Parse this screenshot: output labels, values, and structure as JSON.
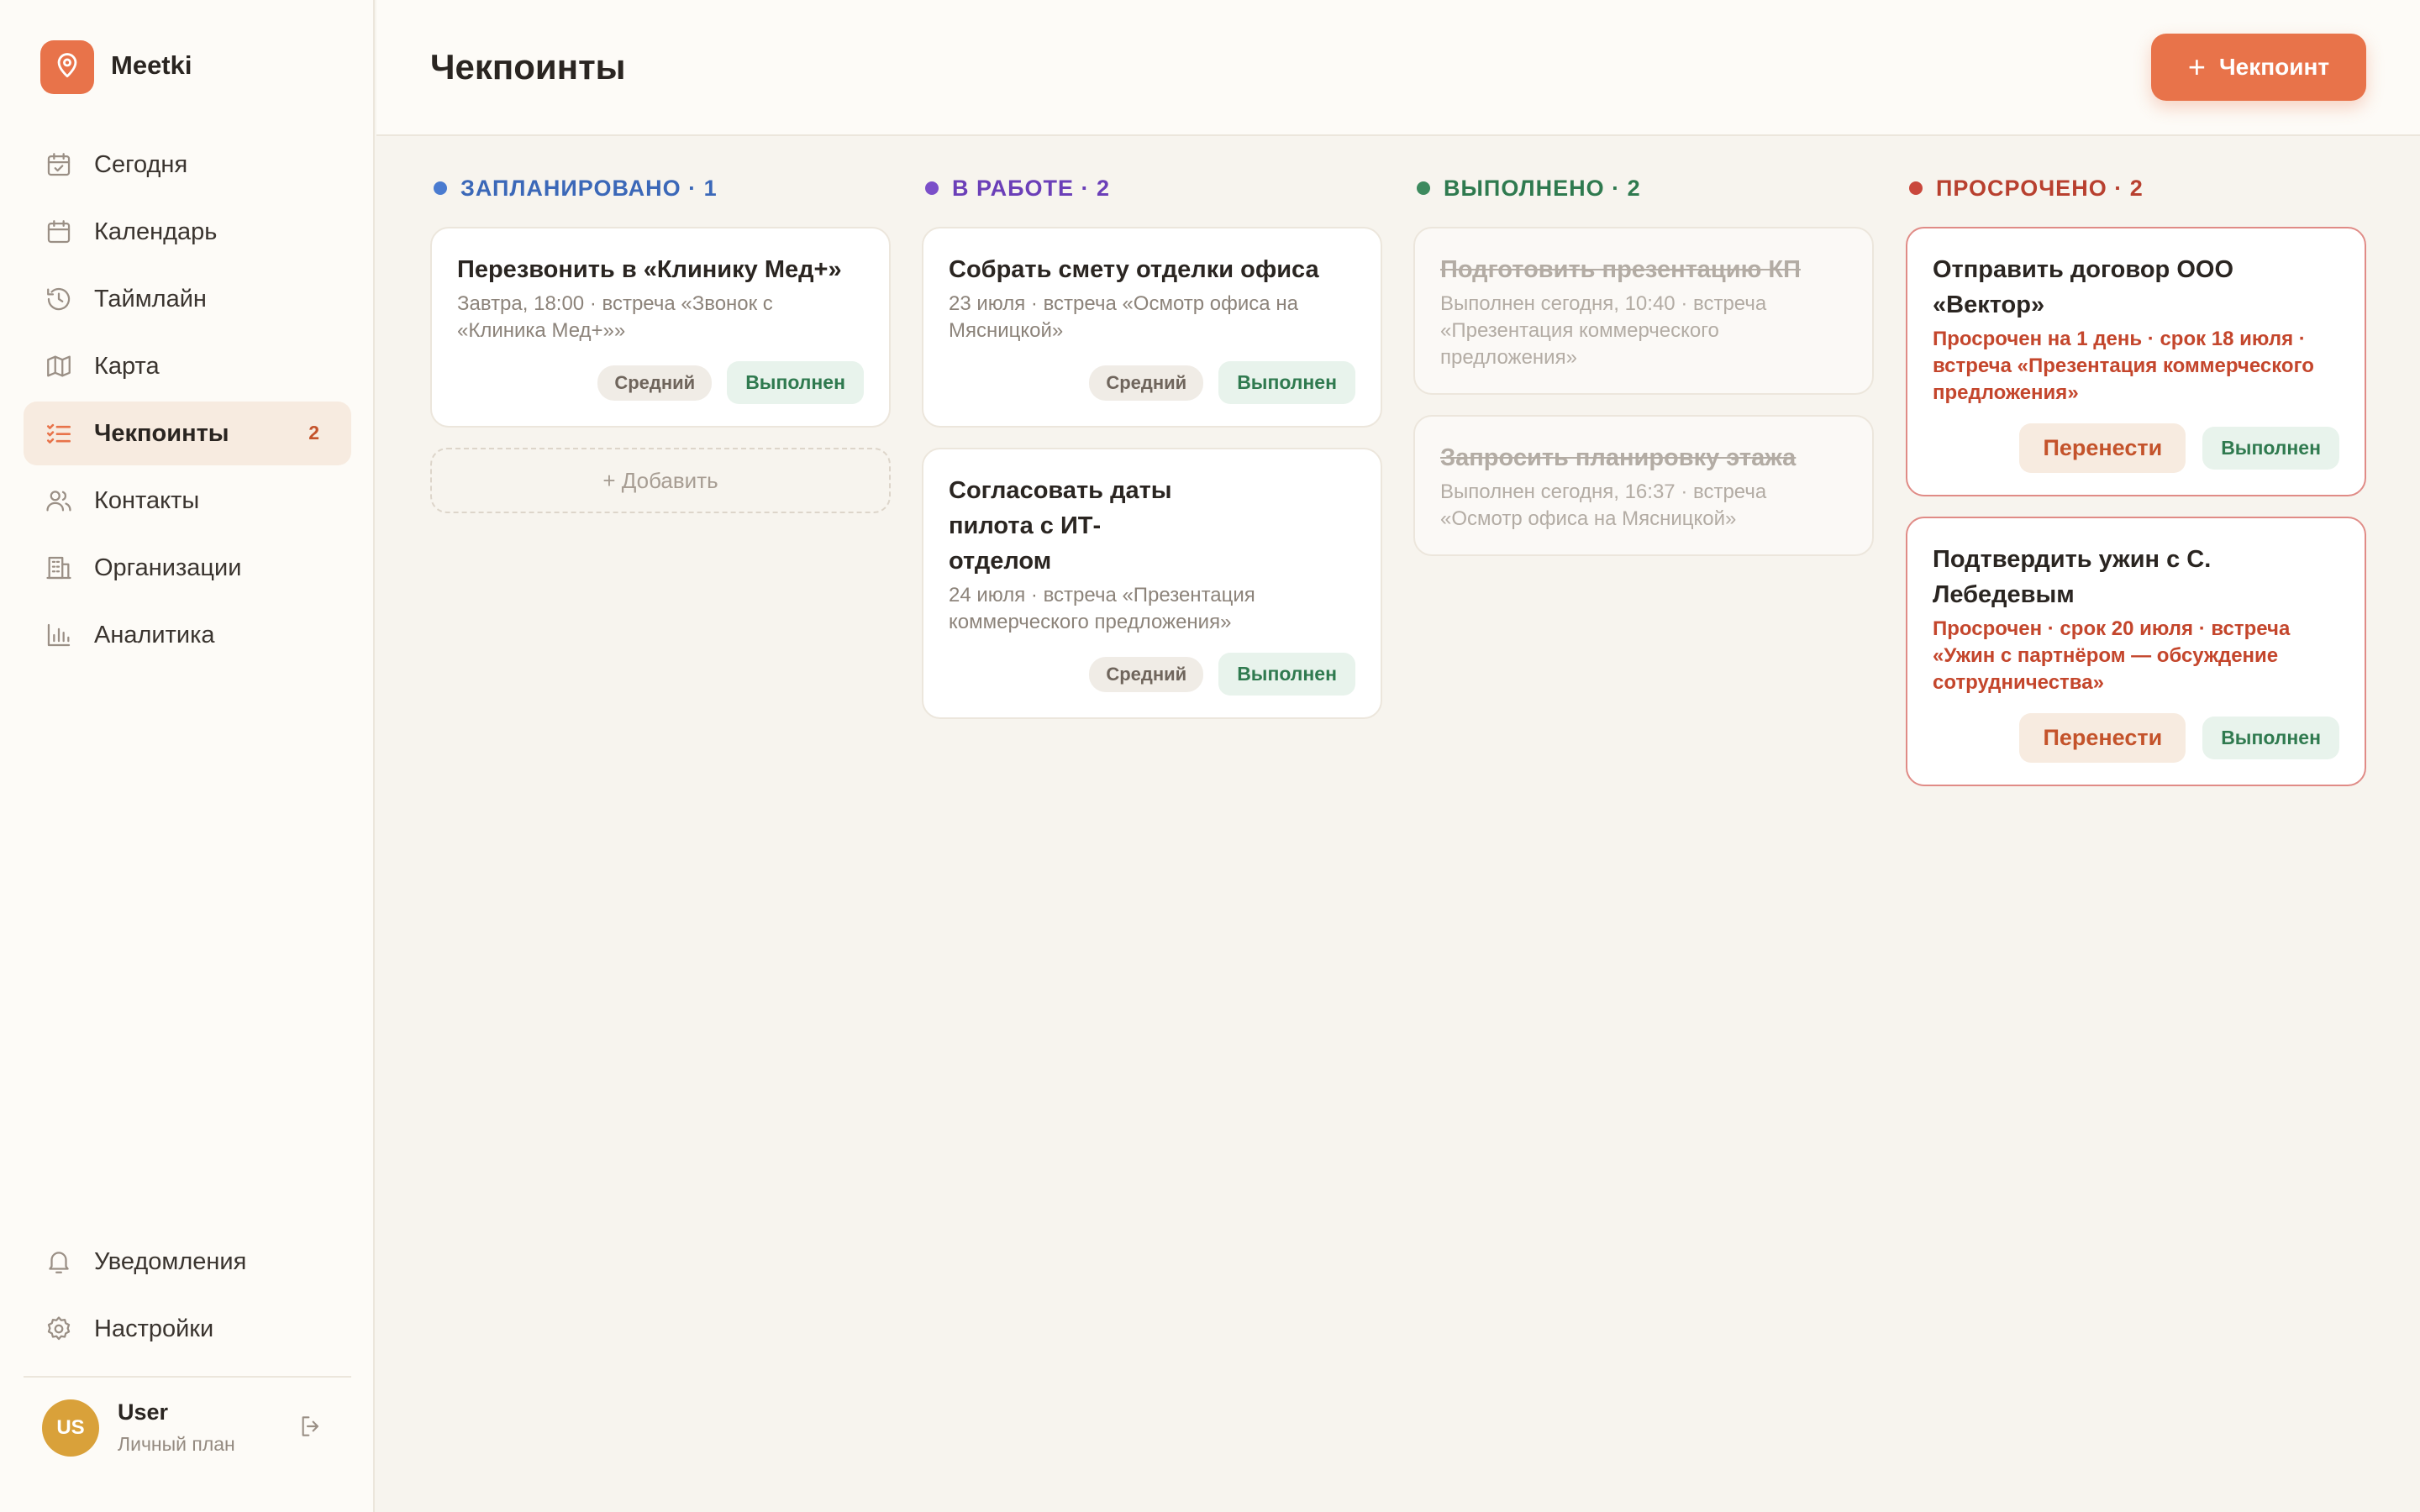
{
  "app": {
    "name": "Meetki"
  },
  "sidebar": {
    "items": [
      {
        "label": "Сегодня",
        "icon": "calendar-check-icon"
      },
      {
        "label": "Календарь",
        "icon": "calendar-icon"
      },
      {
        "label": "Таймлайн",
        "icon": "history-icon"
      },
      {
        "label": "Карта",
        "icon": "map-icon"
      },
      {
        "label": "Чекпоинты",
        "icon": "checklist-icon",
        "badge": "2",
        "active": true
      },
      {
        "label": "Контакты",
        "icon": "users-icon"
      },
      {
        "label": "Организации",
        "icon": "building-icon"
      },
      {
        "label": "Аналитика",
        "icon": "bar-chart-icon"
      }
    ],
    "bottom": [
      {
        "label": "Уведомления",
        "icon": "bell-icon"
      },
      {
        "label": "Настройки",
        "icon": "gear-icon"
      }
    ],
    "user": {
      "initials": "US",
      "name": "User",
      "plan": "Личный план"
    }
  },
  "header": {
    "title": "Чекпоинты",
    "add_label": "Чекпоинт"
  },
  "colors": {
    "accent": "#e8734a",
    "planned": "#4a7bd0",
    "in_progress": "#7b4fc9",
    "done": "#3d8a5e",
    "overdue": "#c9473c"
  },
  "columns": [
    {
      "title": "ЗАПЛАНИРОВАНО · 1",
      "cards": [
        {
          "title": "Перезвонить в «Клинику Мед+»",
          "meta": "Завтра, 18:00 · встреча «Звонок с «Клиника Мед+»»",
          "priority": "Средний",
          "done_label": "Выполнен"
        }
      ],
      "add_label": "+ Добавить"
    },
    {
      "title": "В РАБОТЕ · 2",
      "cards": [
        {
          "title": "Собрать смету отделки офиса",
          "meta": "23 июля · встреча «Осмотр офиса на Мясницкой»",
          "priority": "Средний",
          "done_label": "Выполнен"
        },
        {
          "title": "Согласовать даты пилота с ИТ-отделом",
          "meta": "24 июля · встреча «Презентация коммерческого предложения»",
          "priority": "Средний",
          "done_label": "Выполнен"
        }
      ]
    },
    {
      "title": "ВЫПОЛНЕНО · 2",
      "cards": [
        {
          "title": "Подготовить презентацию КП",
          "meta": "Выполнен сегодня, 10:40 · встреча «Презентация коммерческого предложения»"
        },
        {
          "title": "Запросить планировку этажа",
          "meta": "Выполнен сегодня, 16:37 · встреча «Осмотр офиса на Мясницкой»"
        }
      ]
    },
    {
      "title": "ПРОСРОЧЕНО · 2",
      "cards": [
        {
          "title": "Отправить договор ООО «Вектор»",
          "meta": "Просрочен на 1 день · срок 18 июля · встреча «Презентация коммерческого предложения»",
          "move_label": "Перенести",
          "done_label": "Выполнен"
        },
        {
          "title": "Подтвердить ужин с С. Лебедевым",
          "meta": "Просрочен · срок 20 июля · встреча «Ужин с партнёром — обсуждение сотрудничества»",
          "move_label": "Перенести",
          "done_label": "Выполнен"
        }
      ]
    }
  ]
}
